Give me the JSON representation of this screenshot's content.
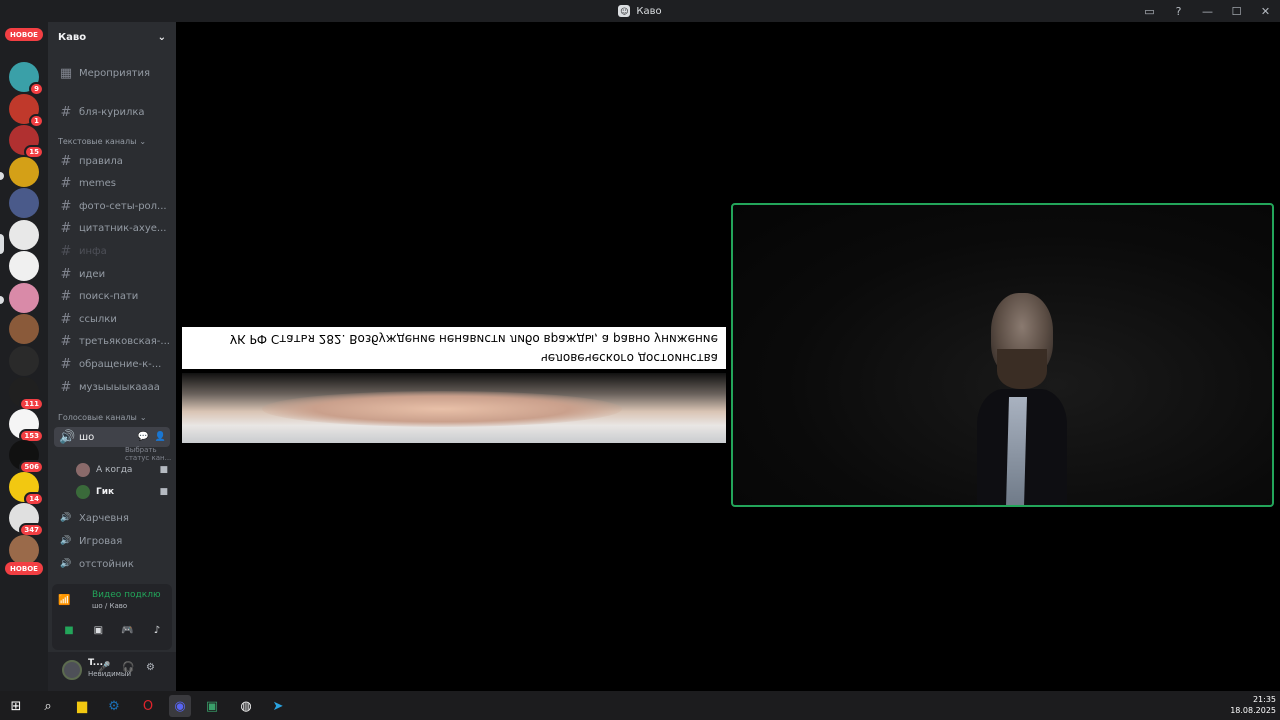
{
  "window": {
    "title": "Каво",
    "controls": [
      "inbox-icon",
      "help-icon",
      "minimize-icon",
      "maximize-icon",
      "close-icon"
    ]
  },
  "rail": {
    "new_label_top": "НОВОЕ",
    "new_label_bottom": "НОВОЕ",
    "servers": [
      {
        "name": "server-1",
        "badge": "9",
        "color": "#3aa0a8"
      },
      {
        "name": "server-2",
        "badge": "1",
        "color": "#c0392b"
      },
      {
        "name": "server-3",
        "badge": "15",
        "color": "#b03030"
      },
      {
        "name": "server-4",
        "badge": "",
        "color": "#d4a017"
      },
      {
        "name": "server-5",
        "badge": "",
        "color": "#4a5a8a"
      },
      {
        "name": "server-6",
        "badge": "",
        "color": "#e8e8e8"
      },
      {
        "name": "server-7",
        "badge": "",
        "color": "#f0f0f0"
      },
      {
        "name": "server-8",
        "badge": "",
        "color": "#d98aa8"
      },
      {
        "name": "server-9",
        "badge": "",
        "color": "#8a5a3a"
      },
      {
        "name": "server-10",
        "badge": "",
        "color": "#2a2a2a"
      },
      {
        "name": "server-11",
        "badge": "111",
        "color": "#202020"
      },
      {
        "name": "server-12",
        "badge": "153",
        "color": "#f5f5f5"
      },
      {
        "name": "server-13",
        "badge": "506",
        "color": "#111"
      },
      {
        "name": "server-14",
        "badge": "14",
        "color": "#f2c811"
      },
      {
        "name": "server-15",
        "badge": "347",
        "color": "#e0e0e0"
      },
      {
        "name": "server-16",
        "badge": "",
        "color": "#9a6a4a"
      }
    ]
  },
  "sidebar": {
    "server_name": "Каво",
    "events_label": "Мероприятия",
    "top_channel": "бля-курилка",
    "text_category": "Текстовые каналы",
    "text_channels": [
      {
        "label": "правила",
        "muted": false
      },
      {
        "label": "memes",
        "muted": false
      },
      {
        "label": "фото-сеты-рол...",
        "muted": false
      },
      {
        "label": "цитатник-ахуе...",
        "muted": false
      },
      {
        "label": "инфа",
        "muted": true
      },
      {
        "label": "идеи",
        "muted": false
      },
      {
        "label": "поиск-пати",
        "muted": false
      },
      {
        "label": "ссылки",
        "muted": false
      },
      {
        "label": "третьяковская-...",
        "muted": false
      },
      {
        "label": "обращение-к-...",
        "muted": false
      },
      {
        "label": "музыыыыкаааа",
        "muted": false
      }
    ],
    "voice_category": "Голосовые каналы",
    "active_voice": {
      "label": "шо",
      "status_prompt": "Выбрать статус кан..."
    },
    "voice_users": [
      {
        "name": "А когда",
        "color": "#8a6a6a"
      },
      {
        "name": "Гик",
        "color": "#3a6a3a"
      }
    ],
    "voice_channels": [
      "Харчевня",
      "Игровая",
      "отстойник"
    ]
  },
  "voice_panel": {
    "status": "Видео подклю",
    "location": "шо / Каво"
  },
  "user": {
    "name": "T...",
    "status": "Невидимый"
  },
  "stage": {
    "caption_line1": "УК РФ Статья 282. Возбуждение ненависти либо вражды, а равно унижение",
    "caption_line2": "человеческого достоинства"
  },
  "taskbar": {
    "time": "21:35",
    "date": "18.08.2025"
  }
}
